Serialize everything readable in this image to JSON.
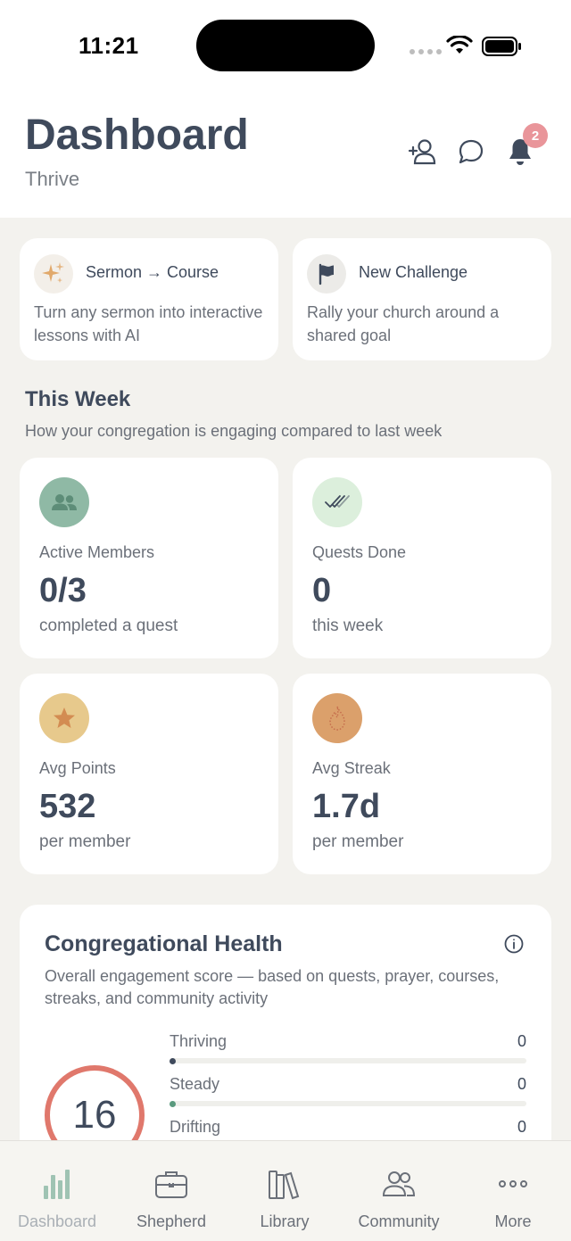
{
  "status_bar": {
    "time": "11:21"
  },
  "header": {
    "title": "Dashboard",
    "subtitle": "Thrive",
    "notification_count": "2"
  },
  "actions": [
    {
      "title": "Sermon → Course",
      "description": "Turn any sermon into interactive lessons with AI",
      "icon": "sparkles-icon"
    },
    {
      "title": "New Challenge",
      "description": "Rally your church around a shared goal",
      "icon": "flag-icon"
    }
  ],
  "this_week": {
    "title": "This Week",
    "subtitle": "How your congregation is engaging compared to last week",
    "stats": [
      {
        "label": "Active Members",
        "value": "0/3",
        "sub": "completed a quest",
        "icon": "members-icon",
        "color": "#8fb9a5"
      },
      {
        "label": "Quests Done",
        "value": "0",
        "sub": "this week",
        "icon": "double-check-icon",
        "color": "#dcefdc"
      },
      {
        "label": "Avg Points",
        "value": "532",
        "sub": "per member",
        "icon": "star-icon",
        "color": "#e7c98c"
      },
      {
        "label": "Avg Streak",
        "value": "1.7d",
        "sub": "per member",
        "icon": "flame-icon",
        "color": "#dba06b"
      }
    ]
  },
  "health": {
    "title": "Congregational Health",
    "description": "Overall engagement score — based on quests, prayer, courses, streaks, and community activity",
    "score": "16",
    "rows": [
      {
        "label": "Thriving",
        "count": "0",
        "color": "#3f4a5c"
      },
      {
        "label": "Steady",
        "count": "0",
        "color": "#5a9a7e"
      },
      {
        "label": "Drifting",
        "count": "0",
        "color": "#d9a441"
      }
    ]
  },
  "tabs": [
    {
      "label": "Dashboard",
      "icon": "bar-chart-icon",
      "active": true
    },
    {
      "label": "Shepherd",
      "icon": "briefcase-icon",
      "active": false
    },
    {
      "label": "Library",
      "icon": "books-icon",
      "active": false
    },
    {
      "label": "Community",
      "icon": "people-icon",
      "active": false
    },
    {
      "label": "More",
      "icon": "more-icon",
      "active": false
    }
  ]
}
